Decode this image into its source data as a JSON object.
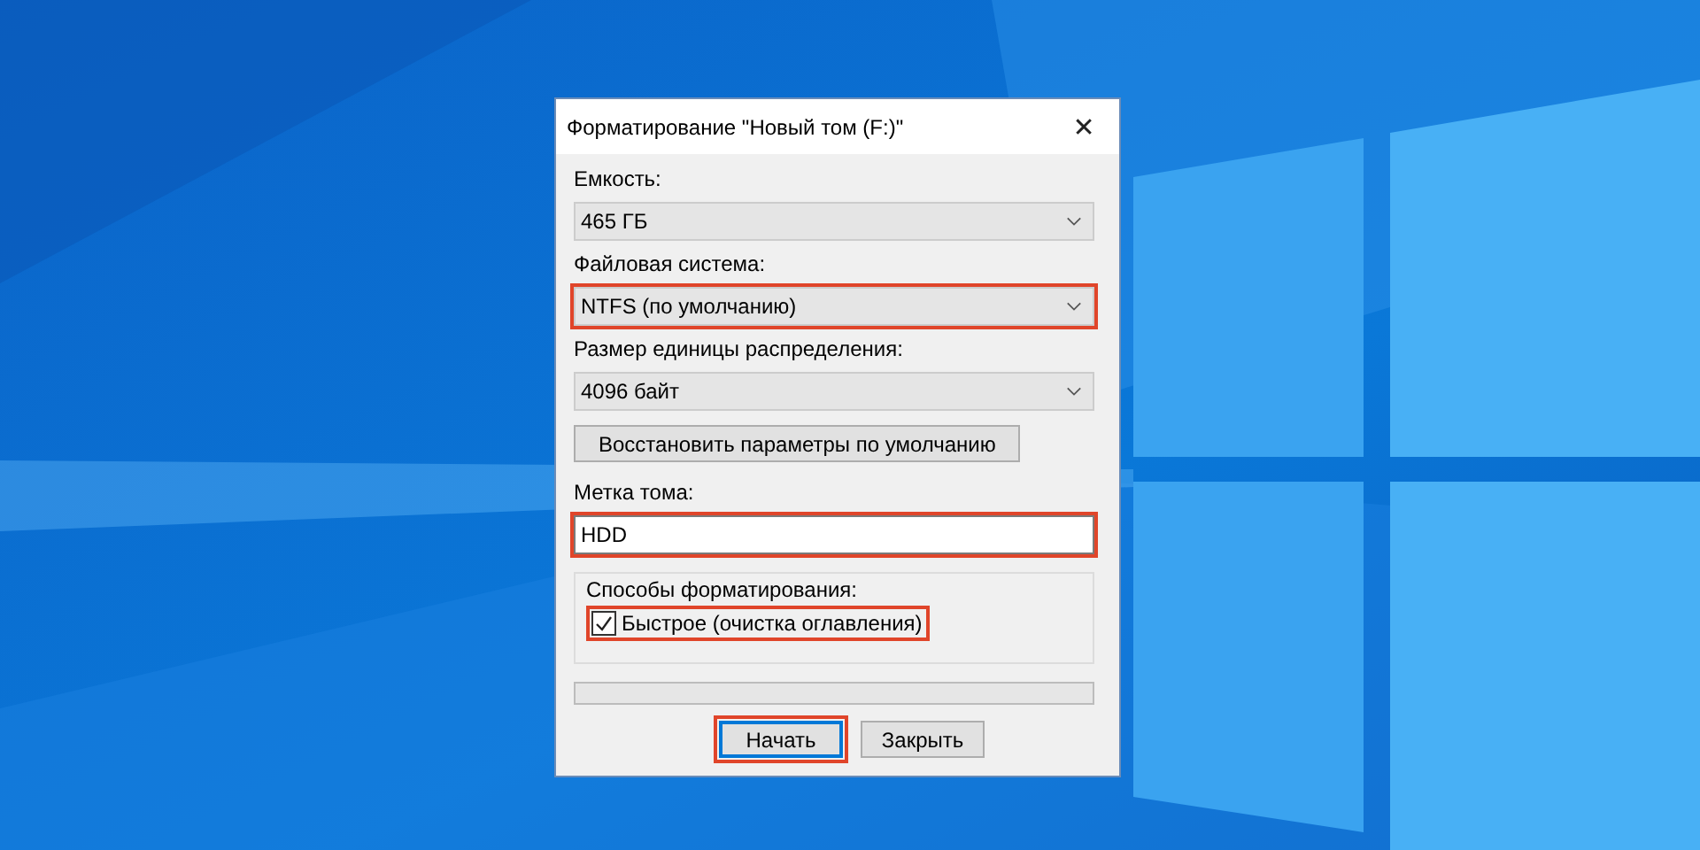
{
  "window": {
    "title": "Форматирование \"Новый том (F:)\"",
    "close": "✕"
  },
  "fields": [
    {
      "kind": "combo",
      "label": "Емкость:",
      "value": "465 ГБ",
      "highlighted": false
    },
    {
      "kind": "combo",
      "label": "Файловая система:",
      "value": "NTFS (по умолчанию)",
      "highlighted": true
    },
    {
      "kind": "combo",
      "label": "Размер единицы распределения:",
      "value": "4096 байт",
      "highlighted": false
    },
    {
      "kind": "button",
      "label": "Восстановить параметры по умолчанию",
      "highlighted": false
    },
    {
      "kind": "text",
      "label": "Метка тома:",
      "value": "HDD",
      "highlighted": true
    }
  ],
  "format_options": {
    "title": "Способы форматирования:",
    "options": [
      {
        "label": "Быстрое (очистка оглавления)",
        "checked": true,
        "highlighted": true
      }
    ]
  },
  "progress": {
    "level": 0
  },
  "buttons": [
    {
      "label": "Начать",
      "default": true,
      "highlighted": true
    },
    {
      "label": "Закрыть",
      "default": false,
      "highlighted": false
    }
  ]
}
